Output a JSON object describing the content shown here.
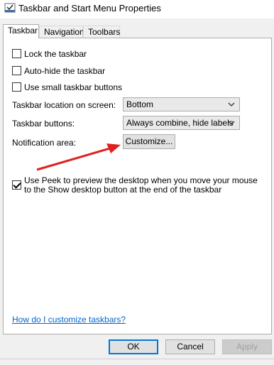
{
  "window": {
    "title": "Taskbar and Start Menu Properties",
    "icon": "taskbar-properties-icon"
  },
  "tabs": [
    {
      "label": "Taskbar",
      "active": true
    },
    {
      "label": "Navigation",
      "active": false
    },
    {
      "label": "Toolbars",
      "active": false
    }
  ],
  "options": {
    "lock": {
      "label": "Lock the taskbar",
      "checked": false
    },
    "autohide": {
      "label": "Auto-hide the taskbar",
      "checked": false
    },
    "small": {
      "label": "Use small taskbar buttons",
      "checked": false
    }
  },
  "location": {
    "label": "Taskbar location on screen:",
    "value": "Bottom"
  },
  "buttons_setting": {
    "label": "Taskbar buttons:",
    "value": "Always combine, hide labels"
  },
  "notification": {
    "label": "Notification area:",
    "button": "Customize..."
  },
  "peek": {
    "text": "Use Peek to preview the desktop when you move your mouse to the Show desktop button at the end of the taskbar",
    "checked": true
  },
  "help_link": "How do I customize taskbars?",
  "footer": {
    "ok": "OK",
    "cancel": "Cancel",
    "apply": "Apply"
  },
  "annotation": {
    "arrow_color": "#e02020"
  }
}
